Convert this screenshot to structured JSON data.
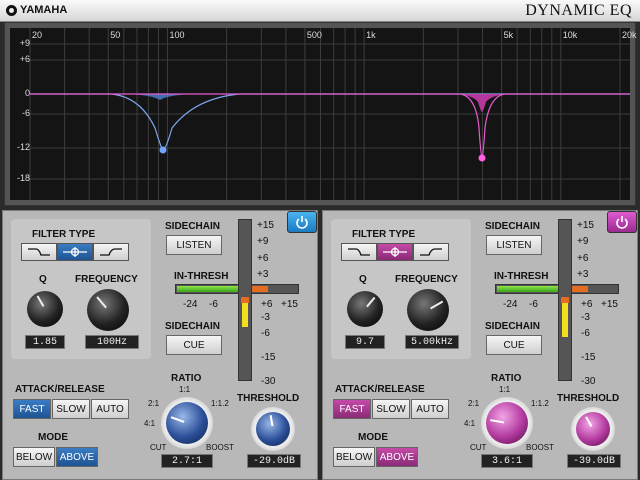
{
  "titlebar": {
    "brand": "YAMAHA",
    "product": "DYNAMIC EQ"
  },
  "graph": {
    "y_labels": [
      "+9",
      "+6",
      "0",
      "-6",
      "-12",
      "-18"
    ],
    "x_labels": [
      "20",
      "50",
      "100",
      "500",
      "1k",
      "5k",
      "10k",
      "20k"
    ],
    "colors": {
      "band1": "#6f9ae0",
      "band2": "#e04fc4"
    }
  },
  "band1": {
    "filter_type_label": "FILTER TYPE",
    "filter_types": [
      "low-shelf-icon",
      "peaking-icon",
      "high-shelf-icon"
    ],
    "selected_filter": 1,
    "q_label": "Q",
    "q_value": "1.85",
    "frequency_label": "FREQUENCY",
    "frequency_value": "100Hz",
    "sidechain_label": "SIDECHAIN",
    "listen_label": "LISTEN",
    "in_thresh_label": "IN-THRESH",
    "in_thresh_scale": [
      "-24",
      "-6",
      "+6",
      "+15"
    ],
    "sidechain_label2": "SIDECHAIN",
    "cue_label": "CUE",
    "gain_scale": [
      "+15",
      "+9",
      "+6",
      "+3",
      "-3",
      "-6",
      "-15",
      "-30"
    ],
    "attack_release_label": "ATTACK/RELEASE",
    "attack_options": [
      "FAST",
      "SLOW",
      "AUTO"
    ],
    "attack_selected": "FAST",
    "mode_label": "MODE",
    "mode_options": [
      "BELOW",
      "ABOVE"
    ],
    "mode_selected": "ABOVE",
    "ratio_label": "RATIO",
    "ratio_top": "1:1",
    "ratio_left_1": "2:1",
    "ratio_left_2": "4:1",
    "ratio_right": "1:1.2",
    "ratio_cut": "CUT",
    "ratio_boost": "BOOST",
    "ratio_value": "2.7:1",
    "threshold_label": "THRESHOLD",
    "threshold_value": "-29.0dB",
    "power_icon": "power-icon"
  },
  "band2": {
    "filter_type_label": "FILTER TYPE",
    "filter_types": [
      "low-shelf-icon",
      "peaking-icon",
      "high-shelf-icon"
    ],
    "selected_filter": 1,
    "q_label": "Q",
    "q_value": "9.7",
    "frequency_label": "FREQUENCY",
    "frequency_value": "5.00kHz",
    "sidechain_label": "SIDECHAIN",
    "listen_label": "LISTEN",
    "in_thresh_label": "IN-THRESH",
    "in_thresh_scale": [
      "-24",
      "-6",
      "+6",
      "+15"
    ],
    "sidechain_label2": "SIDECHAIN",
    "cue_label": "CUE",
    "gain_scale": [
      "+15",
      "+9",
      "+6",
      "+3",
      "-3",
      "-6",
      "-15",
      "-30"
    ],
    "attack_release_label": "ATTACK/RELEASE",
    "attack_options": [
      "FAST",
      "SLOW",
      "AUTO"
    ],
    "attack_selected": "FAST",
    "mode_label": "MODE",
    "mode_options": [
      "BELOW",
      "ABOVE"
    ],
    "mode_selected": "ABOVE",
    "ratio_label": "RATIO",
    "ratio_top": "1:1",
    "ratio_left_1": "2:1",
    "ratio_left_2": "4:1",
    "ratio_right": "1:1.2",
    "ratio_cut": "CUT",
    "ratio_boost": "BOOST",
    "ratio_value": "3.6:1",
    "threshold_label": "THRESHOLD",
    "threshold_value": "-39.0dB",
    "power_icon": "power-icon"
  }
}
